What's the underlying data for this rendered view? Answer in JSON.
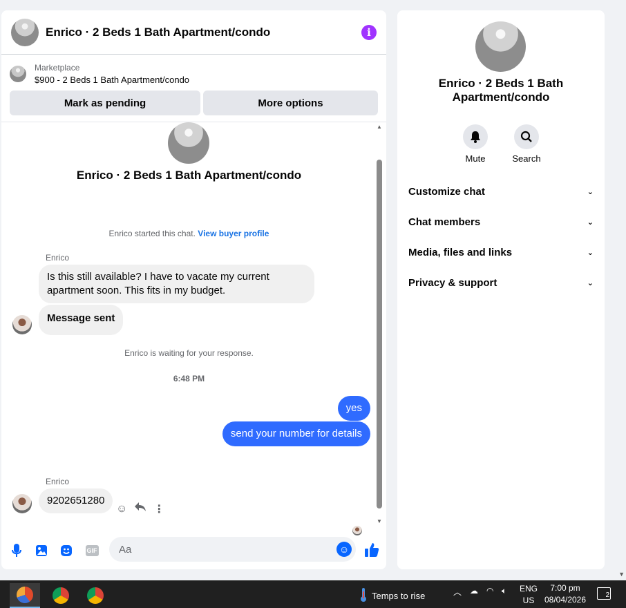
{
  "chat": {
    "header_title": "Enrico · 2 Beds 1 Bath Apartment/condo",
    "info_icon": "i",
    "marketplace_label": "Marketplace",
    "listing_price_title": "$900 - 2 Beds 1 Bath Apartment/condo",
    "mark_pending_label": "Mark as pending",
    "more_options_label": "More options",
    "thread_title": "Enrico · 2 Beds 1 Bath Apartment/condo",
    "started_text": "Enrico started this chat.",
    "view_profile_link": "View buyer profile",
    "sender_name_1": "Enrico",
    "msg_1": "Is this still available? I have to vacate my current apartment soon. This fits in my budget.",
    "msg_2": "Message sent",
    "waiting_text": "Enrico is waiting for your response.",
    "time_divider": "6:48 PM",
    "out_msg_1": "yes",
    "out_msg_2": "send your number for details",
    "sender_name_2": "Enrico",
    "msg_3": "9202651280",
    "composer_placeholder": "Aa",
    "gif_label": "GIF"
  },
  "side": {
    "title": "Enrico · 2 Beds 1 Bath Apartment/condo",
    "mute_label": "Mute",
    "search_label": "Search",
    "menu": [
      {
        "label": "Customize chat"
      },
      {
        "label": "Chat members"
      },
      {
        "label": "Media, files and links"
      },
      {
        "label": "Privacy & support"
      }
    ]
  },
  "taskbar": {
    "weather_text": "Temps to rise",
    "lang_top": "ENG",
    "lang_bottom": "US",
    "time": "7:00 pm",
    "date": "08/04/2026",
    "notif_count": "2"
  },
  "colors": {
    "accent": "#0866ff",
    "outgoing_bubble": "#2f6bff",
    "info_purple": "#a033ff"
  }
}
